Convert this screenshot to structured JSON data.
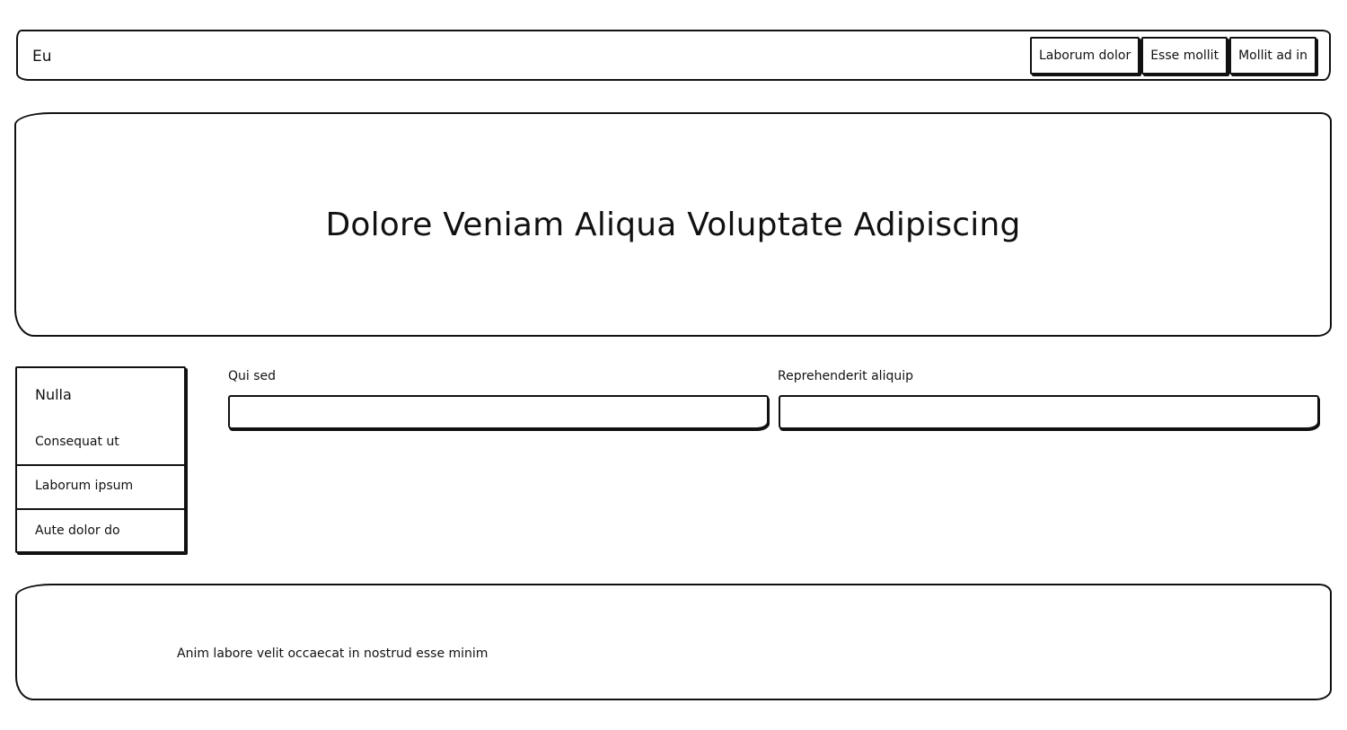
{
  "header": {
    "brand": "Eu",
    "nav": [
      {
        "label": "Laborum dolor"
      },
      {
        "label": "Esse mollit"
      },
      {
        "label": "Mollit ad in"
      }
    ]
  },
  "hero": {
    "title": "Dolore Veniam Aliqua Voluptate Adipiscing"
  },
  "sidebar": {
    "title": "Nulla",
    "items": [
      {
        "label": "Consequat ut"
      },
      {
        "label": "Laborum ipsum"
      },
      {
        "label": "Aute dolor do"
      }
    ]
  },
  "form": {
    "fields": [
      {
        "label": "Qui sed",
        "value": ""
      },
      {
        "label": "Reprehenderit aliquip",
        "value": ""
      }
    ]
  },
  "footer": {
    "text": "Anim labore velit occaecat in nostrud esse minim"
  }
}
